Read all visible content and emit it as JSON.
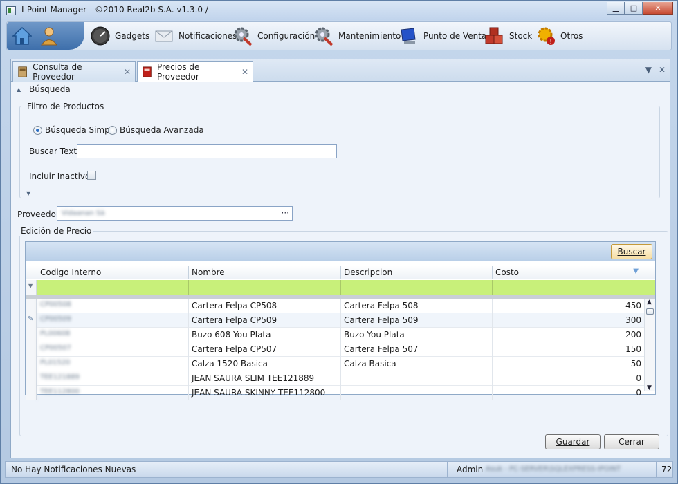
{
  "window": {
    "title": "I-Point Manager - ©2010 Real2b S.A. v1.3.0 /",
    "controls": {
      "minimize": "▁",
      "maximize": "□",
      "close": "✕"
    }
  },
  "menu": [
    {
      "label": "Gadgets",
      "icon": "gauge-icon"
    },
    {
      "label": "Notificaciones",
      "icon": "envelope-icon"
    },
    {
      "label": "Configuración",
      "icon": "gear-wrench-icon"
    },
    {
      "label": "Mantenimiento",
      "icon": "gear-wrench-icon"
    },
    {
      "label": "Punto de Venta",
      "icon": "monitor-icon"
    },
    {
      "label": "Stock",
      "icon": "boxes-icon"
    },
    {
      "label": "Otros",
      "icon": "gear-warning-icon"
    }
  ],
  "tabs": [
    {
      "label": "Consulta de Proveedor",
      "active": false
    },
    {
      "label": "Precios de Proveedor",
      "active": true
    }
  ],
  "search": {
    "section_label": "Búsqueda",
    "filter_group_label": "Filtro de Productos",
    "radio_simple": "Búsqueda Simple",
    "radio_advanced": "Búsqueda Avanzada",
    "selected_mode": "simple",
    "search_text_label": "Buscar Texto",
    "search_text_value": "",
    "include_inactive_label": "Incluir Inactivos",
    "include_inactive_checked": false
  },
  "provider": {
    "label": "Proveedor",
    "value": "Vidaanan Sà"
  },
  "price_edit": {
    "section_label": "Edición de Precio",
    "search_button": "Buscar",
    "columns": [
      "Codigo Interno",
      "Nombre",
      "Descripcion",
      "Costo"
    ],
    "rows": [
      {
        "code": "CP00508",
        "name": "Cartera Felpa CP508",
        "desc": "Cartera Felpa 508",
        "cost": "450"
      },
      {
        "code": "CP00509",
        "name": "Cartera Felpa CP509",
        "desc": "Cartera Felpa 509",
        "cost": "300"
      },
      {
        "code": "PL00608",
        "name": "Buzo 608 You Plata",
        "desc": "Buzo You Plata",
        "cost": "200"
      },
      {
        "code": "CP00507",
        "name": "Cartera Felpa CP507",
        "desc": "Cartera Felpa 507",
        "cost": "150"
      },
      {
        "code": "PL01520",
        "name": "Calza 1520 Basica",
        "desc": "Calza Basica",
        "cost": "50"
      },
      {
        "code": "TEE121889",
        "name": "JEAN SAURA SLIM TEE121889",
        "desc": "",
        "cost": "0"
      },
      {
        "code": "TEE112800",
        "name": "JEAN SAURA SKINNY TEE112800",
        "desc": "",
        "cost": "0"
      }
    ]
  },
  "actions": {
    "save": "Guardar",
    "close": "Cerrar"
  },
  "status": {
    "notifications": "No Hay Notificaciones Nuevas",
    "user": "Admin",
    "server": "Asuk - PC-SERVER\\SQLEXPRESS-IPOINT",
    "number": "72"
  },
  "colors": {
    "filter_row": "#c8f07a",
    "accent": "#3e6fab"
  }
}
